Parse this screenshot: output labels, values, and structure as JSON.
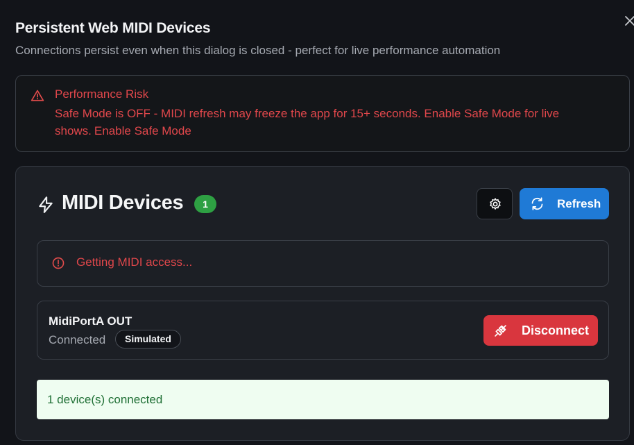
{
  "dialog": {
    "title": "Persistent Web MIDI Devices",
    "subtitle": "Connections persist even when this dialog is closed - perfect for live performance automation",
    "close_icon": "close-icon"
  },
  "risk_alert": {
    "icon": "warning-triangle-icon",
    "title": "Performance Risk",
    "message": "Safe Mode is OFF - MIDI refresh may freeze the app for 15+ seconds. Enable Safe Mode for live shows.",
    "link_label": "Enable Safe Mode",
    "color": "#e0474b"
  },
  "devices_panel": {
    "icon": "lightning-bolt-icon",
    "title": "MIDI Devices",
    "count": "1",
    "settings_icon": "gear-icon",
    "refresh_icon": "refresh-icon",
    "refresh_label": "Refresh",
    "access_status": {
      "icon": "alert-circle-icon",
      "text": "Getting MIDI access..."
    },
    "devices": [
      {
        "name": "MidiPortA OUT",
        "status": "Connected",
        "badge": "Simulated",
        "action_icon": "unplug-icon",
        "action_label": "Disconnect"
      }
    ],
    "summary": "1 device(s) connected"
  },
  "colors": {
    "background": "#121419",
    "panel": "#1c1f25",
    "accent_blue": "#1f7ad6",
    "danger_red": "#d9363e",
    "success_green": "#2ea043",
    "success_bg": "#effdf1"
  }
}
